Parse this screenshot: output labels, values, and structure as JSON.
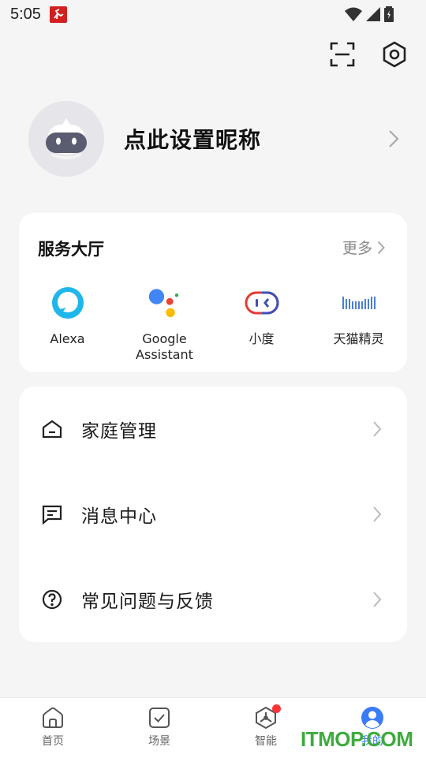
{
  "status_bar": {
    "time": "5:05"
  },
  "profile": {
    "nickname": "点此设置昵称"
  },
  "services": {
    "title": "服务大厅",
    "more_label": "更多",
    "items": [
      {
        "label": "Alexa",
        "icon": "alexa-icon"
      },
      {
        "label": "Google\nAssistant",
        "icon": "google-assistant-icon"
      },
      {
        "label": "小度",
        "icon": "xiaodu-icon"
      },
      {
        "label": "天猫精灵",
        "icon": "tmall-genie-icon"
      }
    ]
  },
  "menu": {
    "items": [
      {
        "label": "家庭管理",
        "icon": "home-icon"
      },
      {
        "label": "消息中心",
        "icon": "message-icon"
      },
      {
        "label": "常见问题与反馈",
        "icon": "help-icon"
      }
    ]
  },
  "bottom_nav": {
    "items": [
      {
        "label": "首页",
        "icon": "home-icon"
      },
      {
        "label": "场景",
        "icon": "checkbox-icon"
      },
      {
        "label": "智能",
        "icon": "smart-icon"
      },
      {
        "label": "我的",
        "icon": "user-icon",
        "active": true
      }
    ]
  },
  "watermark": "ITMOP.COM",
  "colors": {
    "accent": "#3a7bf7",
    "badge": "#ff3333",
    "background": "#f5f5f5"
  }
}
